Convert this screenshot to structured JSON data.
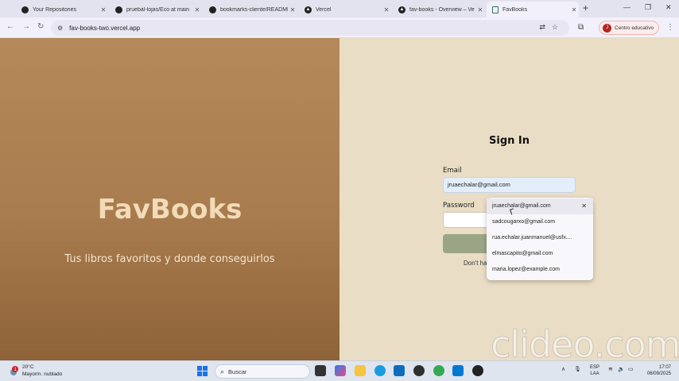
{
  "browser": {
    "tabs": [
      {
        "title": "Your Repositories",
        "icon": "github-icon"
      },
      {
        "title": "pruebal-lojas/Eco at main",
        "icon": "github-icon"
      },
      {
        "title": "bookmarks-cliente/README",
        "icon": "github-icon"
      },
      {
        "title": "Vercel",
        "icon": "vercel-icon"
      },
      {
        "title": "fav-books - Overview – Ve",
        "icon": "vercel-icon"
      },
      {
        "title": "FavBooks",
        "icon": "book-icon",
        "active": true
      }
    ],
    "new_tab": "+",
    "url": "fav-books-two.vercel.app",
    "profile_initial": "J",
    "profile_label": "Centro educativo"
  },
  "page": {
    "brand": "FavBooks",
    "tagline": "Tus libros favoritos y donde conseguirlos",
    "signin_title": "Sign In",
    "email_label": "Email",
    "email_value": "jruaechalar@gmail.com",
    "password_label": "Password",
    "dont_have_prefix": "Don't ha"
  },
  "autofill": {
    "suggestions": [
      "jruaechalar@gmail.com",
      "sadcougarxo@gmail.com",
      "rua.echalar.juanmanuel@usfx....",
      "elmascapito@gmail.com",
      "maria.lopez@example.com"
    ],
    "close": "✕"
  },
  "watermark": "clideo.com",
  "taskbar": {
    "weather_badge": "1",
    "temperature": "20°C",
    "weather_desc": "Mayorm. nublado",
    "search_placeholder": "Buscar",
    "lang_line1": "ESP",
    "lang_line2": "LAA",
    "time": "17:07",
    "date": "06/09/2025"
  },
  "colors": {
    "left_panel": "#a87c4e",
    "right_panel": "#eaddc5",
    "brand_text": "#f1dbb8",
    "submit_button": "#9aa585"
  }
}
